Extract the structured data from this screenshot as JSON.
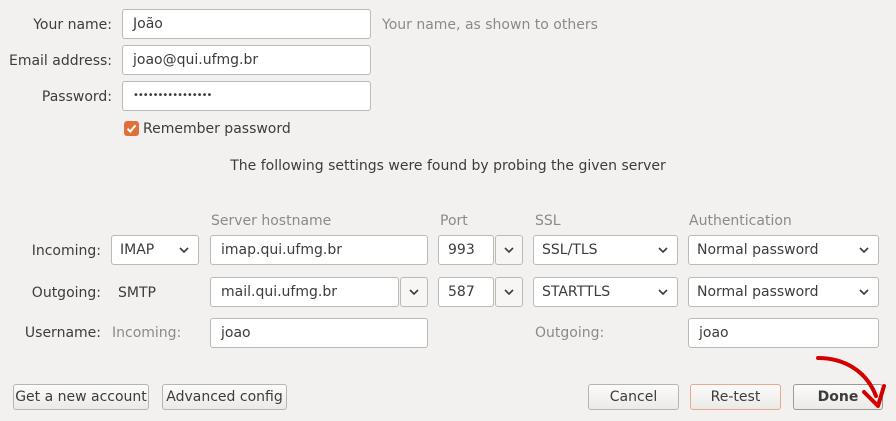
{
  "account": {
    "name_label": "Your name:",
    "name_value": "João",
    "name_hint": "Your name, as shown to others",
    "email_label": "Email address:",
    "email_value": "joao@qui.ufmg.br",
    "password_label": "Password:",
    "password_value": "••••••••••••••••",
    "remember_label": "Remember password",
    "remember_checked": true
  },
  "probe_message": "The following settings were found by probing the given server",
  "columns": {
    "hostname": "Server hostname",
    "port": "Port",
    "ssl": "SSL",
    "auth": "Authentication"
  },
  "incoming": {
    "label": "Incoming:",
    "protocol": "IMAP",
    "hostname": "imap.qui.ufmg.br",
    "port": "993",
    "ssl": "SSL/TLS",
    "auth": "Normal password"
  },
  "outgoing": {
    "label": "Outgoing:",
    "protocol": "SMTP",
    "hostname": "mail.qui.ufmg.br",
    "port": "587",
    "ssl": "STARTTLS",
    "auth": "Normal password"
  },
  "username": {
    "label": "Username:",
    "incoming_label": "Incoming:",
    "incoming_value": "joao",
    "outgoing_label": "Outgoing:",
    "outgoing_value": "joao"
  },
  "buttons": {
    "get_account": "Get a new account",
    "advanced": "Advanced config",
    "cancel": "Cancel",
    "retest": "Re-test",
    "done": "Done"
  },
  "colors": {
    "checkbox": "#e0703a",
    "annotation_arrow": "#d40000",
    "retest_border": "#e8a98f"
  }
}
